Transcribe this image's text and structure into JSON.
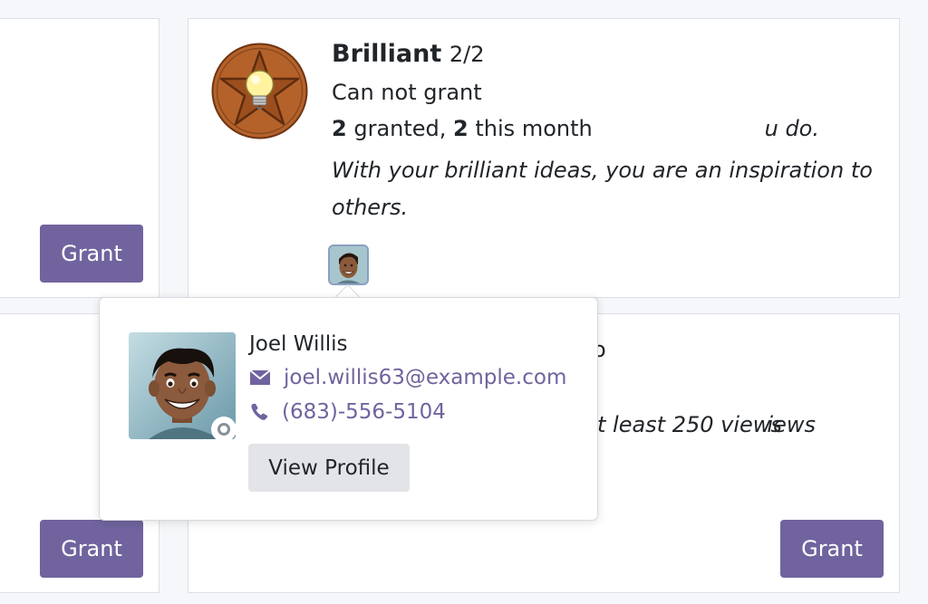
{
  "cards": {
    "left_top_snippet": "u do.",
    "left_bottom_snippet": "iews",
    "right_bottom_snippet": "t least 250 views",
    "right_bottom_title_snippet": "o"
  },
  "grant_label": "Grant",
  "badge": {
    "name": "Brilliant",
    "count": "2/2",
    "status": "Can not grant",
    "granted_count": "2",
    "granted_text": "granted,",
    "month_count": "2",
    "month_text": "this month",
    "description": "With your brilliant ideas, you are an inspiration to others.",
    "icon": "lightbulb-star-badge-icon"
  },
  "popover": {
    "name": "Joel Willis",
    "email": "joel.willis63@example.com",
    "phone": "(683)-556-5104",
    "view_profile": "View Profile",
    "presence": "offline"
  },
  "colors": {
    "accent": "#71639e",
    "background": "#f6f7fa",
    "card_border": "#dcdfe6",
    "badge_bronze": "#b5622a"
  }
}
